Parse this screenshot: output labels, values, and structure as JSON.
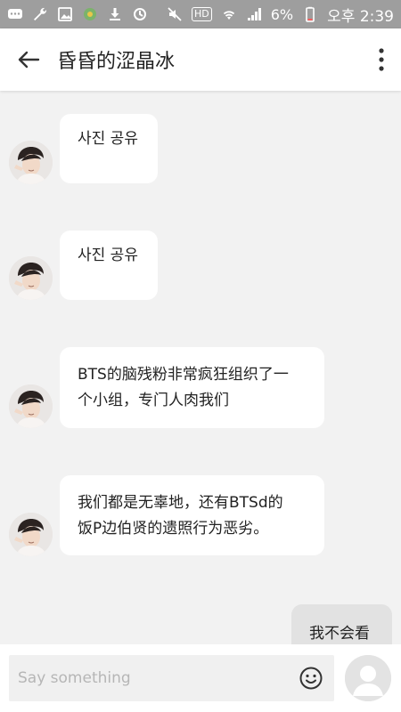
{
  "status_bar": {
    "battery": "6%",
    "time": "오후 2:39",
    "hd_label": "HD"
  },
  "header": {
    "title": "昏昏的涩晶冰",
    "back_icon": "arrow-left-icon",
    "menu_icon": "more-vertical-icon"
  },
  "messages": [
    {
      "sender": "other",
      "text": "사진 공유"
    },
    {
      "sender": "other",
      "text": "사진 공유"
    },
    {
      "sender": "other",
      "line1": "BTS的脑残粉非常疯狂组织了一",
      "line2": "个小组，专门人肉我们"
    },
    {
      "sender": "other",
      "line1": "我们都是无辜地，还有BTSd的",
      "line2": "饭P边伯贤的遗照行为恶劣。"
    },
    {
      "sender": "me",
      "text": "我不会看"
    }
  ],
  "composer": {
    "placeholder": "Say something",
    "value": "",
    "emoji_icon": "smiley-icon",
    "avatar_icon": "default-user-icon"
  },
  "colors": {
    "status_bar_bg": "#9e9e9e",
    "chat_bg": "#f2f2f2",
    "bubble_other": "#ffffff",
    "bubble_me": "#e2e2e2"
  }
}
